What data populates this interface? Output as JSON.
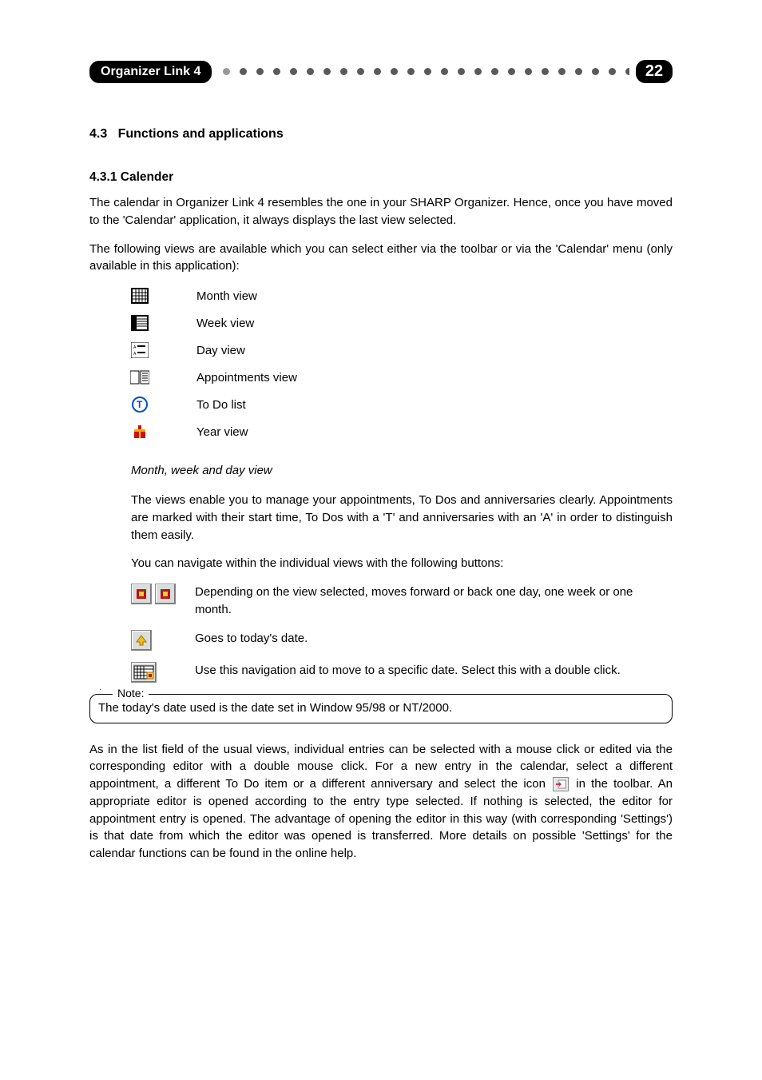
{
  "header": {
    "title": "Organizer Link 4",
    "page_number": "22"
  },
  "section": {
    "num": "4.3",
    "title": "Functions and applications"
  },
  "subsection": {
    "num": "4.3.1",
    "title": "Calender"
  },
  "intro": {
    "p1": "The calendar in Organizer Link 4 resembles the one in your SHARP Organizer. Hence, once you have moved to the 'Calendar' application, it always displays the last view selected.",
    "p2": "The following views are available which you can select either via the toolbar or via the 'Calendar' menu (only available in this application):"
  },
  "views": [
    {
      "icon": "month-view-icon",
      "label": "Month view"
    },
    {
      "icon": "week-view-icon",
      "label": "Week view"
    },
    {
      "icon": "day-view-icon",
      "label": "Day view"
    },
    {
      "icon": "appointments-view-icon",
      "label": "Appointments view"
    },
    {
      "icon": "todo-list-icon",
      "label": "To Do list"
    },
    {
      "icon": "year-view-icon",
      "label": "Year view"
    }
  ],
  "mwd": {
    "heading": "Month, week and day view",
    "p1": "The views enable you to manage your appointments, To Dos and anniversaries clearly. Appointments are marked with their start time, To Dos with a 'T' and anniversaries with an 'A' in order to distinguish them easily.",
    "p2": "You can navigate within the individual views with the following buttons:"
  },
  "nav": [
    {
      "icon": "prev-next-icon",
      "desc": "Depending on the view selected, moves forward or back one day, one week or one month."
    },
    {
      "icon": "today-icon",
      "desc": "Goes to today's date."
    },
    {
      "icon": "goto-date-icon",
      "desc": "Use this navigation aid to move to a specific date. Select this with a double click."
    }
  ],
  "note": {
    "label": "Note:",
    "text": "The today's date used is the date set in Window 95/98 or NT/2000."
  },
  "closing": {
    "pre": "As in the list field of the usual views, individual entries can be selected with a mouse click or edited via the corresponding editor with a double mouse click. For a new entry in the calendar, select a different appointment, a different To Do item or a different anniversary and select the icon ",
    "post": " in the toolbar. An appropriate editor is opened according to the entry type selected. If nothing is selected, the editor for appointment entry is opened. The advantage of opening the editor in this way (with corresponding 'Settings') is that date from which the editor was opened is transferred. More details on possible 'Settings' for the calendar functions can be found in the online help."
  }
}
